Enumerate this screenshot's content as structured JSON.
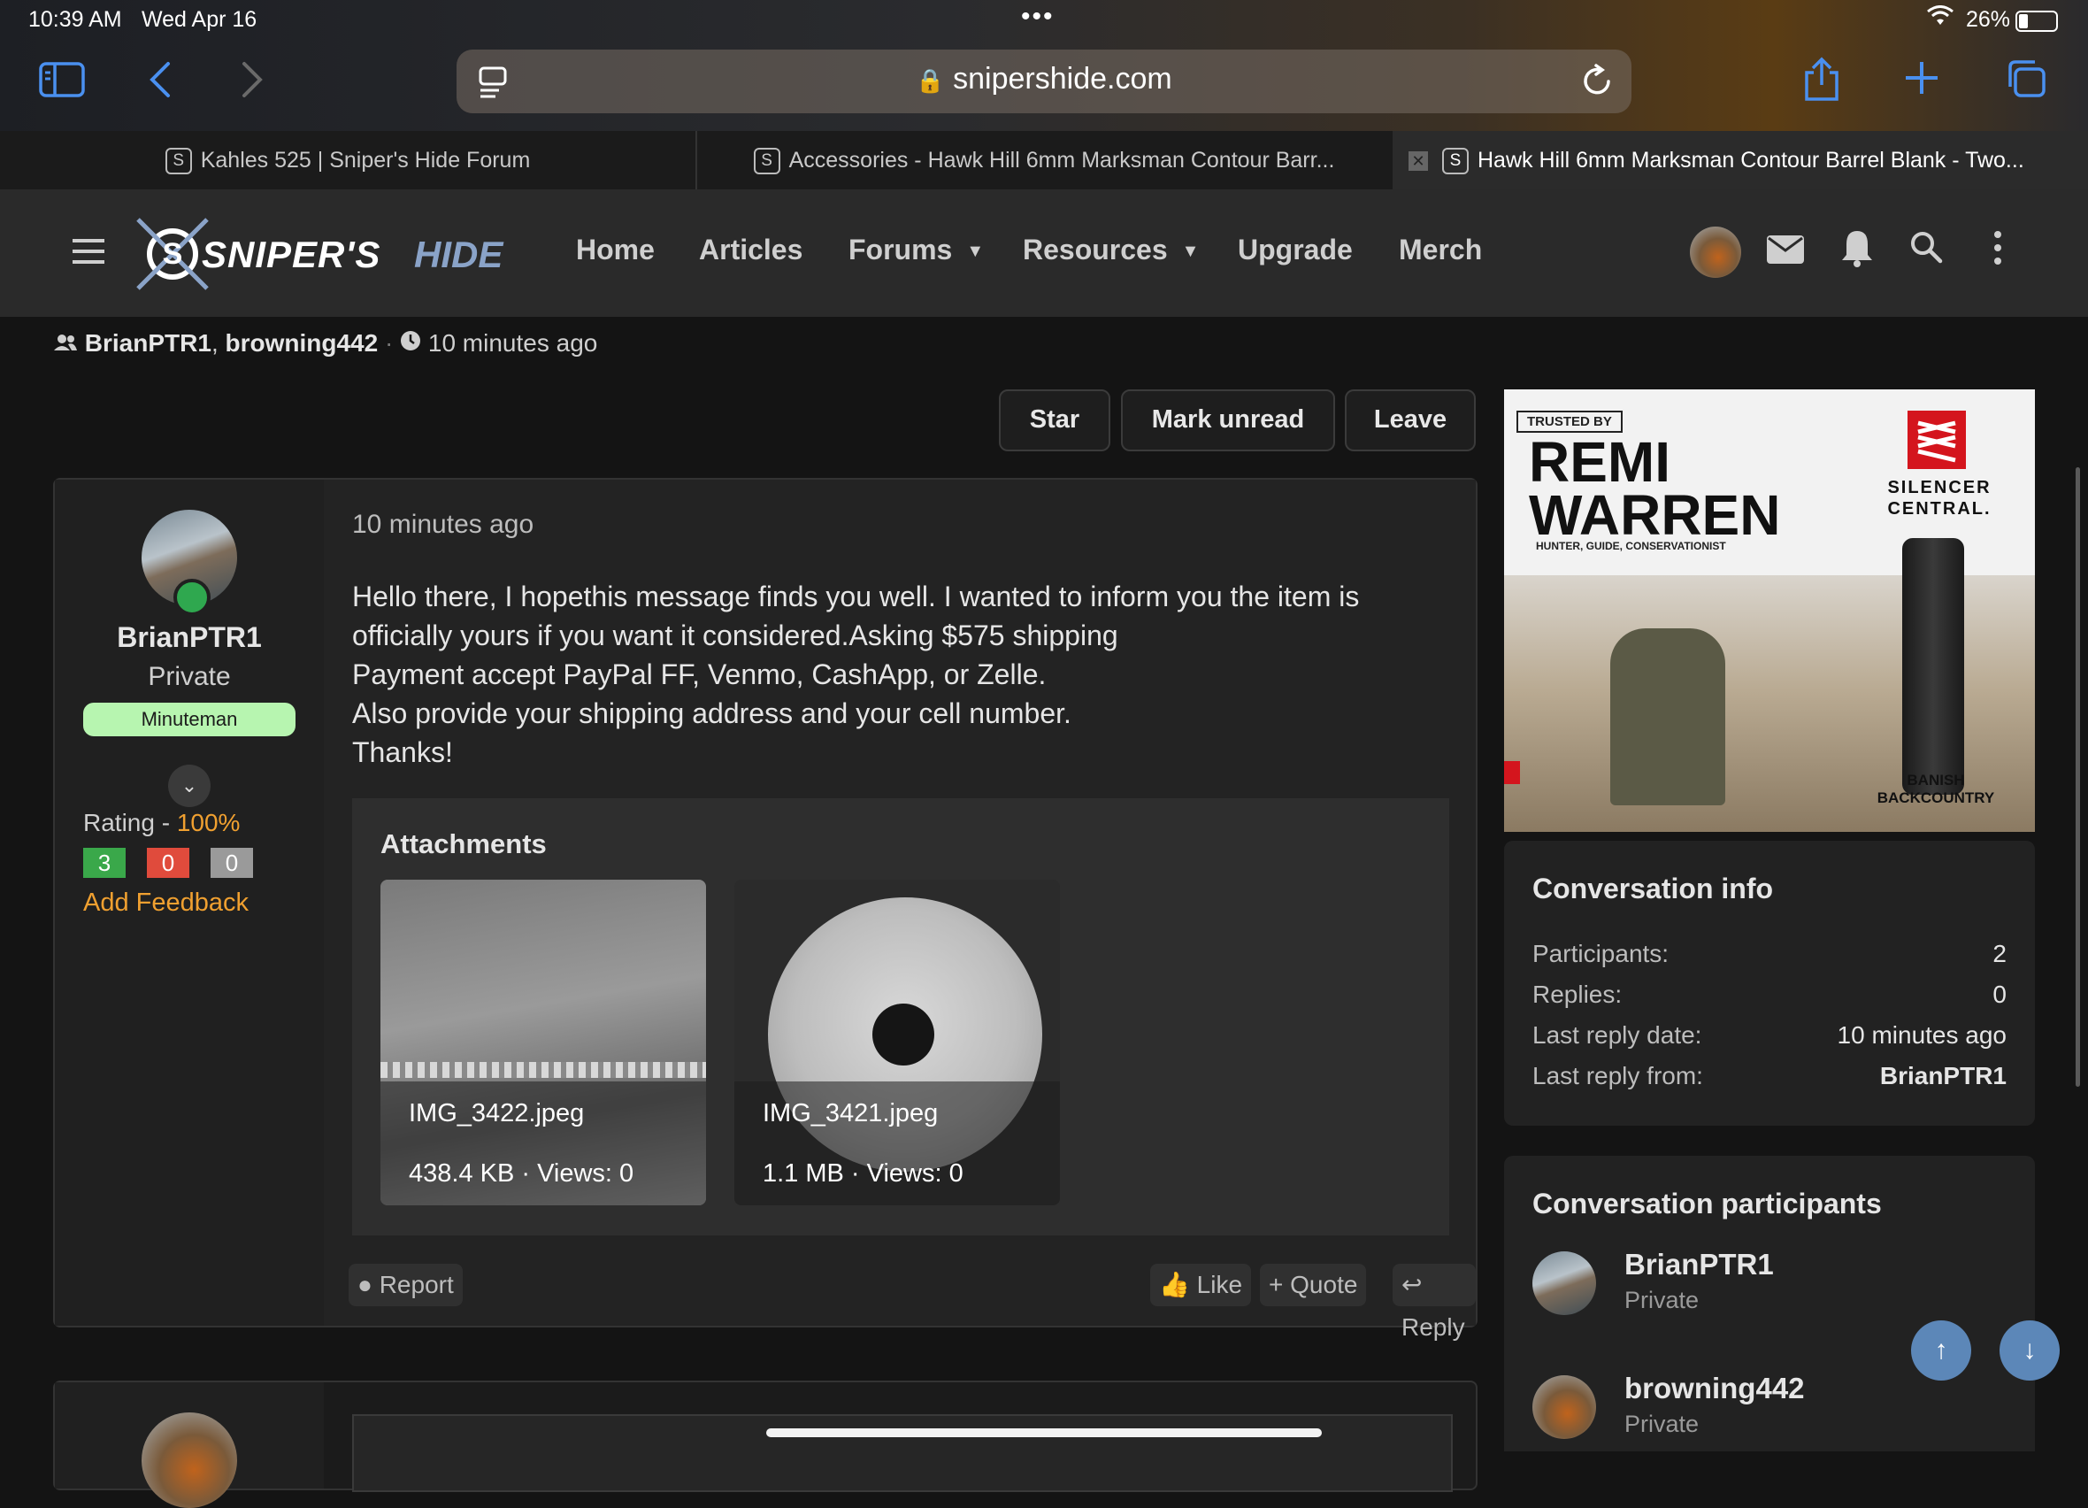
{
  "status_bar": {
    "time": "10:39 AM",
    "date": "Wed Apr 16",
    "battery": "26%"
  },
  "browser": {
    "url": "snipershide.com",
    "tabs": [
      {
        "favicon": "S",
        "title": "Kahles 525 | Sniper's Hide Forum"
      },
      {
        "favicon": "S",
        "title": "Accessories - Hawk Hill 6mm Marksman Contour Barr..."
      },
      {
        "favicon": "S",
        "title": "Hawk Hill 6mm Marksman Contour Barrel Blank - Two..."
      }
    ]
  },
  "site": {
    "logo_text_1": "SNIPER'S",
    "logo_text_2": "HIDE",
    "nav": [
      {
        "label": "Home"
      },
      {
        "label": "Articles"
      },
      {
        "label": "Forums"
      },
      {
        "label": "Resources"
      },
      {
        "label": "Upgrade"
      },
      {
        "label": "Merch"
      }
    ]
  },
  "conversation": {
    "participant_1": "BrianPTR1",
    "participant_2": "browning442",
    "time_ago": "10 minutes ago",
    "buttons": {
      "star": "Star",
      "mark_unread": "Mark unread",
      "leave": "Leave"
    }
  },
  "message": {
    "user": {
      "name": "BrianPTR1",
      "title": "Private",
      "badge": "Minuteman",
      "rating_label": "Rating - ",
      "rating_value": "100%",
      "positive": "3",
      "negative": "0",
      "neutral": "0",
      "add_feedback": "Add Feedback"
    },
    "time": "10 minutes ago",
    "lines": [
      "Hello there, I hopethis message finds you well. I wanted to inform you the item is",
      "officially yours if you want it considered.Asking $575 shipping",
      "Payment accept PayPal FF, Venmo, CashApp, or Zelle.",
      "Also provide your shipping address and your cell number.",
      "Thanks!"
    ],
    "attachments_title": "Attachments",
    "attachments": [
      {
        "name": "IMG_3422.jpeg",
        "info": "438.4 KB · Views: 0"
      },
      {
        "name": "IMG_3421.jpeg",
        "info": "1.1 MB · Views: 0"
      }
    ],
    "actions": {
      "report": "Report",
      "like": "Like",
      "quote": "Quote",
      "reply": "Reply"
    }
  },
  "ad": {
    "trusted_by": "TRUSTED BY",
    "name_1": "REMI",
    "name_2": "WARREN",
    "tagline": "HUNTER, GUIDE, CONSERVATIONIST",
    "brand_1": "SILENCER",
    "brand_2": "CENTRAL.",
    "product_1": "BANISH",
    "product_2": "BACKCOUNTRY"
  },
  "conversation_info": {
    "title": "Conversation info",
    "rows": [
      {
        "label": "Participants:",
        "value": "2"
      },
      {
        "label": "Replies:",
        "value": "0"
      },
      {
        "label": "Last reply date:",
        "value": "10 minutes ago"
      },
      {
        "label": "Last reply from:",
        "value": "BrianPTR1"
      }
    ]
  },
  "participants": {
    "title": "Conversation participants",
    "list": [
      {
        "name": "BrianPTR1",
        "role": "Private"
      },
      {
        "name": "browning442",
        "role": "Private"
      }
    ]
  },
  "colors": {
    "accent_orange": "#f0a030",
    "positive": "#3aa84a",
    "negative": "#e04b3c",
    "neutral": "#9a9a9a",
    "ios_blue": "#4a90f0"
  }
}
